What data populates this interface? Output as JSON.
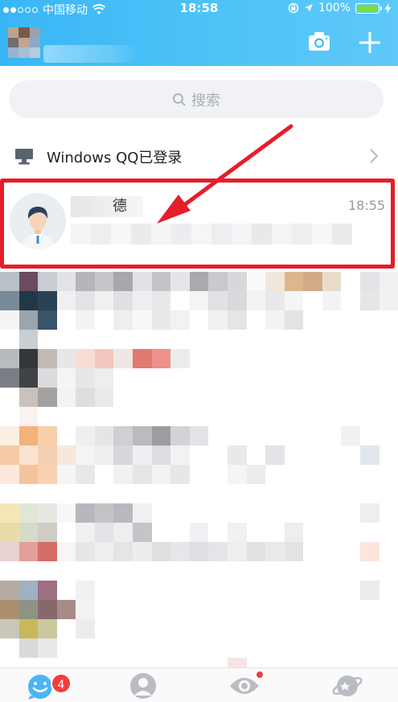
{
  "status_bar": {
    "carrier": "中国移动",
    "time": "18:58",
    "battery_percent": "100%",
    "battery_level": 1.0
  },
  "header": {
    "camera_icon": "camera-icon",
    "add_icon": "plus-icon"
  },
  "search": {
    "placeholder": "搜索"
  },
  "windows_login": {
    "label": "Windows QQ已登录",
    "icon": "monitor-icon"
  },
  "conversation": {
    "name_visible_char": "德",
    "time": "18:55"
  },
  "tab_bar": {
    "tabs": [
      {
        "icon": "messages-icon",
        "badge": "4"
      },
      {
        "icon": "contacts-icon"
      },
      {
        "icon": "discover-eye-icon",
        "dot": true
      },
      {
        "icon": "planet-icon"
      }
    ]
  },
  "colors": {
    "header": "#3fbaf6",
    "highlight_border": "#e51e2b",
    "badge": "#f23d3d"
  }
}
